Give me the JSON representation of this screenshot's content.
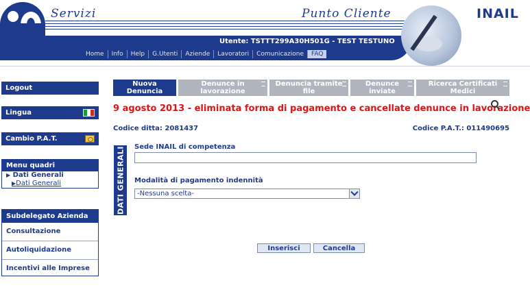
{
  "header": {
    "servizi": "Servizi",
    "punto_cliente": "Punto Cliente",
    "brand": "INAIL",
    "user": "Utente: TSTTT299A30H501G - TEST TESTUNO",
    "nav": [
      "Home",
      "Info",
      "Help",
      "G.Utenti",
      "Aziende",
      "Lavoratori",
      "Comunicazione",
      "FAQ"
    ]
  },
  "sidebar": {
    "logout": "Logout",
    "lingua": "Lingua",
    "cambio_pat": "Cambio P.A.T.",
    "menu_quadri": {
      "title": "Menu quadri",
      "main": "Dati Generali",
      "sub": "Dati Generali"
    },
    "subdelegato": {
      "title": "Subdelegato Azienda",
      "links": [
        "Consultazione",
        "Autoliquidazione",
        "Incentivi alle Imprese"
      ]
    }
  },
  "tabs": [
    {
      "line1": "Nuova",
      "line2": "Denuncia",
      "active": true
    },
    {
      "line1": "Denunce in",
      "line2": "lavorazione",
      "active": false
    },
    {
      "line1": "Denuncia tramite",
      "line2": "file",
      "active": false
    },
    {
      "line1": "Denunce",
      "line2": "inviate",
      "active": false
    },
    {
      "line1": "Ricerca Certificati",
      "line2": "Medici",
      "active": false
    }
  ],
  "main": {
    "announcement": "9 agosto 2013 - eliminata forma di pagamento e cancellate denunce in lavorazione",
    "codice_ditta": "Codice ditta: 2081437",
    "codice_pat": "Codice P.A.T.: 011490695",
    "section_label": "DATI GENERALI",
    "sede_label": "Sede INAIL di competenza",
    "sede_value": "",
    "modalita_label": "Modalità di pagamento indennità",
    "modalita_value": "-Nessuna scelta-",
    "inserisci": "Inserisci",
    "cancella": "Cancella"
  },
  "colors": {
    "brand": "#1e3a8c",
    "alert": "#e01212",
    "tab_inactive": "#b0b4bc"
  }
}
